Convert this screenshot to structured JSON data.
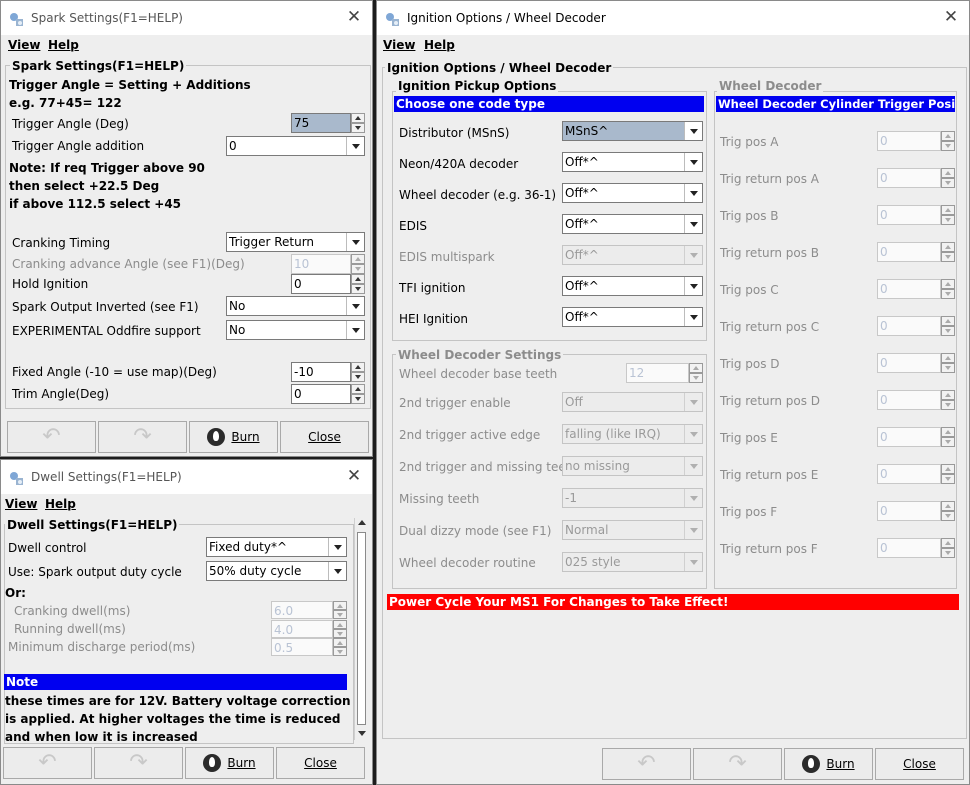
{
  "spark": {
    "title": "Spark Settings(F1=HELP)",
    "menu": {
      "view": "View",
      "help": "Help"
    },
    "group_title": "Spark Settings(F1=HELP)",
    "header_lines": [
      "Trigger Angle = Setting + Additions",
      "e.g. 77+45= 122"
    ],
    "trigger_angle": {
      "label": "Trigger Angle (Deg)",
      "value": "75"
    },
    "trigger_addition": {
      "label": "Trigger Angle addition",
      "value": "0"
    },
    "notes": [
      "Note: If req Trigger above 90",
      "then select +22.5 Deg",
      "if above 112.5 select +45"
    ],
    "cranking_timing": {
      "label": "Cranking Timing",
      "value": "Trigger Return"
    },
    "cranking_advance": {
      "label": "Cranking advance Angle (see F1)(Deg)",
      "value": "10"
    },
    "hold_ignition": {
      "label": "Hold Ignition",
      "value": "0"
    },
    "spark_inverted": {
      "label": "Spark Output Inverted (see F1)",
      "value": "No"
    },
    "oddfire": {
      "label": "EXPERIMENTAL Oddfire support",
      "value": "No"
    },
    "fixed_angle": {
      "label": "Fixed Angle (-10 = use map)(Deg)",
      "value": "-10"
    },
    "trim_angle": {
      "label": "Trim Angle(Deg)",
      "value": "0"
    },
    "burn": "Burn",
    "close": "Close"
  },
  "dwell": {
    "title": "Dwell Settings(F1=HELP)",
    "menu": {
      "view": "View",
      "help": "Help"
    },
    "group_title": "Dwell Settings(F1=HELP)",
    "dwell_control": {
      "label": "Dwell control",
      "value": "Fixed duty*^"
    },
    "duty_cycle": {
      "label": "Use: Spark output duty cycle",
      "value": "50% duty cycle"
    },
    "or_label": "Or:",
    "cranking_dwell": {
      "label": "Cranking dwell(ms)",
      "value": "6.0"
    },
    "running_dwell": {
      "label": "Running dwell(ms)",
      "value": "4.0"
    },
    "min_discharge": {
      "label": "Minimum discharge period(ms)",
      "value": "0.5"
    },
    "note_title": "Note",
    "note_lines": [
      "these times are for 12V. Battery voltage correction",
      "is applied. At higher voltages the time is reduced",
      "and when low it is increased"
    ],
    "burn": "Burn",
    "close": "Close"
  },
  "ignition": {
    "title": "Ignition Options / Wheel Decoder",
    "menu": {
      "view": "View",
      "help": "Help"
    },
    "outer_title": "Ignition Options / Wheel Decoder",
    "pickup": {
      "title": "Ignition Pickup Options",
      "band": "Choose one code type",
      "rows": [
        {
          "label": "Distributor (MSnS)",
          "value": "MSnS^"
        },
        {
          "label": "Neon/420A decoder",
          "value": "Off*^"
        },
        {
          "label": "Wheel decoder (e.g. 36-1)",
          "value": "Off*^"
        },
        {
          "label": "EDIS",
          "value": "Off*^"
        },
        {
          "label": "EDIS multispark",
          "value": "Off*^"
        },
        {
          "label": "TFI ignition",
          "value": "Off*^"
        },
        {
          "label": "HEI Ignition",
          "value": "Off*^"
        }
      ]
    },
    "wheel_settings": {
      "title": "Wheel Decoder Settings",
      "base_teeth": {
        "label": "Wheel decoder base teeth",
        "value": "12"
      },
      "rows": [
        {
          "label": "2nd trigger enable",
          "value": "Off"
        },
        {
          "label": "2nd trigger active edge",
          "value": "falling (like IRQ)"
        },
        {
          "label": "2nd trigger and missing teeth",
          "value": "no missing"
        },
        {
          "label": "Missing teeth",
          "value": "-1"
        },
        {
          "label": "Dual dizzy mode (see F1)",
          "value": "Normal"
        },
        {
          "label": "Wheel decoder routine",
          "value": "025 style"
        }
      ]
    },
    "wheel_decoder": {
      "title": "Wheel Decoder",
      "band": "Wheel Decoder Cylinder Trigger Positions",
      "rows": [
        {
          "label": "Trig pos A",
          "value": "0"
        },
        {
          "label": "Trig return pos A",
          "value": "0"
        },
        {
          "label": "Trig pos B",
          "value": "0"
        },
        {
          "label": "Trig return pos B",
          "value": "0"
        },
        {
          "label": "Trig pos C",
          "value": "0"
        },
        {
          "label": "Trig return pos C",
          "value": "0"
        },
        {
          "label": "Trig pos D",
          "value": "0"
        },
        {
          "label": "Trig return pos D",
          "value": "0"
        },
        {
          "label": "Trig pos E",
          "value": "0"
        },
        {
          "label": "Trig return pos E",
          "value": "0"
        },
        {
          "label": "Trig pos F",
          "value": "0"
        },
        {
          "label": "Trig return pos F",
          "value": "0"
        }
      ]
    },
    "warning": "Power Cycle Your MS1 For Changes to Take Effect!",
    "burn": "Burn",
    "close": "Close"
  }
}
